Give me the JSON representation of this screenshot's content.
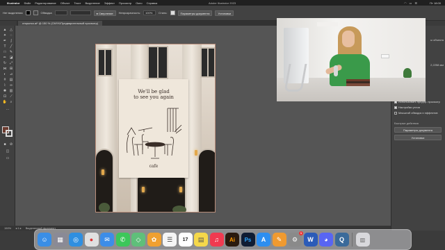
{
  "menubar": {
    "app_name": "Illustrator",
    "menus": [
      "Файл",
      "Редактирование",
      "Объект",
      "Текст",
      "Выделение",
      "Эффект",
      "Просмотр",
      "Окно",
      "Справка"
    ],
    "window_title": "Adobe Illustrator 2023",
    "clock": "Пт 18:00"
  },
  "controlbar": {
    "no_selection": "Нет выделения",
    "stroke_label": "Обводка",
    "brush_label": "Сверление",
    "opacity_label": "Непрозрачность:",
    "opacity_value": "100%",
    "style_label": "Стиль:",
    "doc_setup_button": "Параметры документа",
    "prefs_button": "Установки"
  },
  "document_tab": {
    "label": "открытка.ai* @ 150 % (CMYK/Предварительный просмотр)"
  },
  "artwork": {
    "headline": "We'll be glad\nto see you again",
    "footer": "cafe"
  },
  "properties_panel": {
    "label_top": "ы объекта",
    "value_readout": "2,2258 мм",
    "checkboxes": [
      {
        "label": "Использовать предпр. просмотр",
        "checked": true
      },
      {
        "label": "Настройки углов",
        "checked": true
      },
      {
        "label": "Масштаб обводок и эффектов",
        "checked": false
      }
    ],
    "quick_actions_title": "Быстрые действия",
    "doc_setup_button": "Параметры документа",
    "prefs_button": "Установки"
  },
  "statusbar": {
    "zoom": "150%",
    "tool_name": "Выделенный фрагмент"
  },
  "dock": {
    "apps": [
      {
        "name": "finder-icon",
        "glyph": "☺",
        "color": "#3a8ee6"
      },
      {
        "name": "launchpad-icon",
        "glyph": "▦",
        "color": "#8a8a96"
      },
      {
        "name": "safari-icon",
        "glyph": "◎",
        "color": "#2f8fe0"
      },
      {
        "name": "chrome-icon",
        "glyph": "●",
        "color": "#e0e0e0"
      },
      {
        "name": "mail-icon",
        "glyph": "✉",
        "color": "#3d8de8"
      },
      {
        "name": "messages-icon",
        "glyph": "✆",
        "color": "#3cc75a"
      },
      {
        "name": "maps-icon",
        "glyph": "◇",
        "color": "#5fbf7a"
      },
      {
        "name": "photos-icon",
        "glyph": "✿",
        "color": "#f0a030"
      },
      {
        "name": "reminders-icon",
        "glyph": "☰",
        "color": "#f5f5f5"
      },
      {
        "name": "calendar-icon",
        "glyph": "17",
        "color": "#ffffff"
      },
      {
        "name": "notes-icon",
        "glyph": "▤",
        "color": "#f5d84a"
      },
      {
        "name": "music-icon",
        "glyph": "♫",
        "color": "#f03a50"
      },
      {
        "name": "illustrator-icon",
        "glyph": "Ai",
        "color": "#2a1a0e"
      },
      {
        "name": "photoshop-icon",
        "glyph": "Ps",
        "color": "#0f1c33"
      },
      {
        "name": "appstore-icon",
        "glyph": "A",
        "color": "#2d8ef0"
      },
      {
        "name": "pages-icon",
        "glyph": "✎",
        "color": "#f09a30"
      },
      {
        "name": "system-settings-icon",
        "glyph": "⚙",
        "color": "#8a8a8a"
      },
      {
        "name": "word-icon",
        "glyph": "W",
        "color": "#2b5bb8"
      },
      {
        "name": "discord-icon",
        "glyph": "◕",
        "color": "#5865f2"
      },
      {
        "name": "quicktime-icon",
        "glyph": "Q",
        "color": "#3a6a9a"
      }
    ],
    "trash": {
      "name": "trash-icon",
      "glyph": "🗑",
      "color": "#d8d8dc"
    }
  }
}
